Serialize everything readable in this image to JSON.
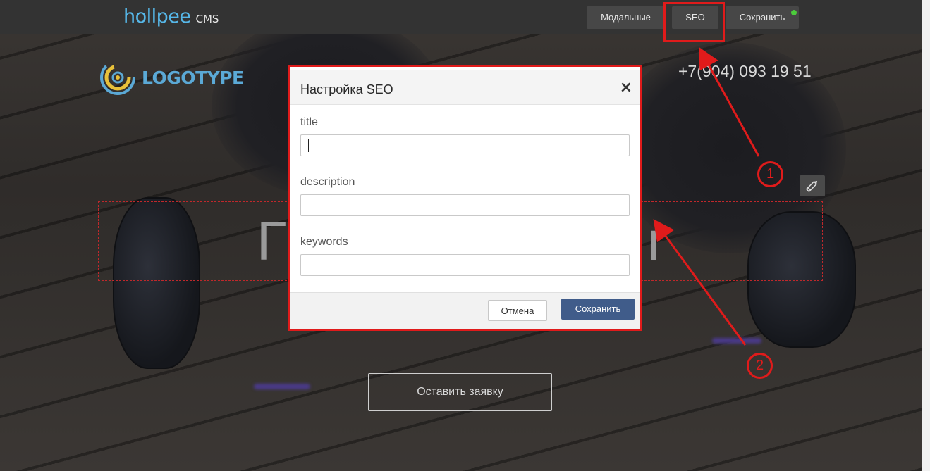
{
  "cms": {
    "brand_name": "hollpee",
    "brand_suffix": "CMS",
    "buttons": {
      "modals": "Модальные",
      "seo": "SEO",
      "save": "Сохранить"
    },
    "save_status_color": "#4ccc3c"
  },
  "page": {
    "logo_text": "LOGOTYPE",
    "phone": "+7(904) 093 19 51",
    "headline_visible_fragments": [
      "Г",
      "ı"
    ],
    "cta_label": "Оставить заявку"
  },
  "seo_modal": {
    "title": "Настройка SEO",
    "close_glyph": "×",
    "fields": [
      {
        "label": "title",
        "value": ""
      },
      {
        "label": "description",
        "value": ""
      },
      {
        "label": "keywords",
        "value": ""
      }
    ],
    "cancel_label": "Отмена",
    "save_label": "Сохранить"
  },
  "annotations": {
    "markers": [
      "1",
      "2"
    ],
    "color": "#e01b1b"
  },
  "icons": {
    "edit": "pencil-icon",
    "close": "close-icon",
    "logo": "logo-mark-icon"
  }
}
